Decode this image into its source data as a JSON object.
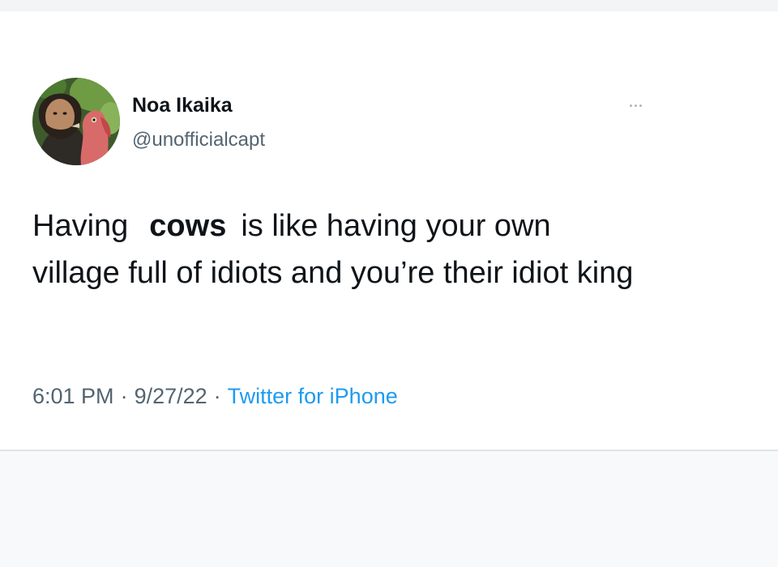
{
  "author": {
    "name": "Noa Ikaika",
    "handle": "@unofficialcapt"
  },
  "tweet": {
    "line1_before": "Having",
    "line1_emphasis": "cows",
    "line1_after": "is like having your own",
    "line2": "village full of idiots and you’re their idiot king"
  },
  "meta": {
    "time": "6:01 PM",
    "date": "9/27/22",
    "source": "Twitter for iPhone",
    "separator": "·"
  },
  "icons": {
    "avatar": "profile-photo-with-turkey",
    "more": "more-horizontal-icon"
  },
  "colors": {
    "text": "#0f1419",
    "secondary": "#536471",
    "link": "#1d9bf0",
    "background": "#ffffff"
  }
}
